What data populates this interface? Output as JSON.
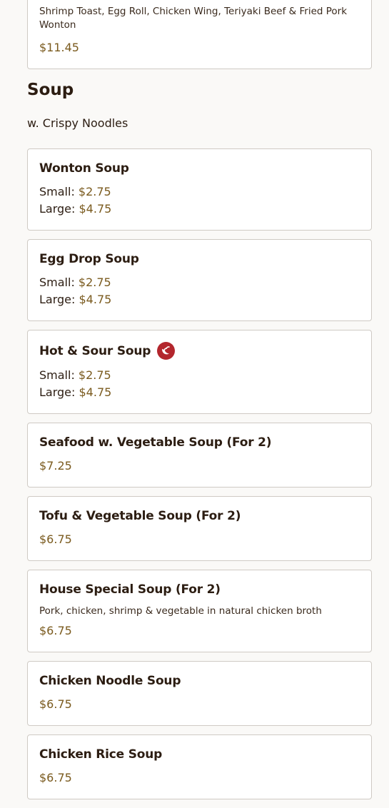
{
  "prev_item": {
    "desc": "Shrimp Toast, Egg Roll, Chicken Wing, Teriyaki Beef & Fried Pork Wonton",
    "price": "$11.45"
  },
  "section": {
    "title": "Soup",
    "note": "w. Crispy Noodles"
  },
  "labels": {
    "small": "Small:",
    "large": "Large:"
  },
  "items": [
    {
      "name": "Wonton Soup",
      "small": "$2.75",
      "large": "$4.75"
    },
    {
      "name": "Egg Drop Soup",
      "small": "$2.75",
      "large": "$4.75"
    },
    {
      "name": "Hot & Sour Soup",
      "small": "$2.75",
      "large": "$4.75",
      "icon": "spicy-icon"
    },
    {
      "name": "Seafood w. Vegetable Soup (For 2)",
      "price": "$7.25"
    },
    {
      "name": "Tofu & Vegetable Soup (For 2)",
      "price": "$6.75"
    },
    {
      "name": "House Special Soup (For 2)",
      "desc": "Pork, chicken, shrimp & vegetable in natural chicken broth",
      "price": "$6.75"
    },
    {
      "name": "Chicken Noodle Soup",
      "price": "$6.75"
    },
    {
      "name": "Chicken Rice Soup",
      "price": "$6.75"
    }
  ],
  "colors": {
    "price": "#7a5a1e",
    "spicy": "#b3262d",
    "border": "#cfcac4"
  }
}
